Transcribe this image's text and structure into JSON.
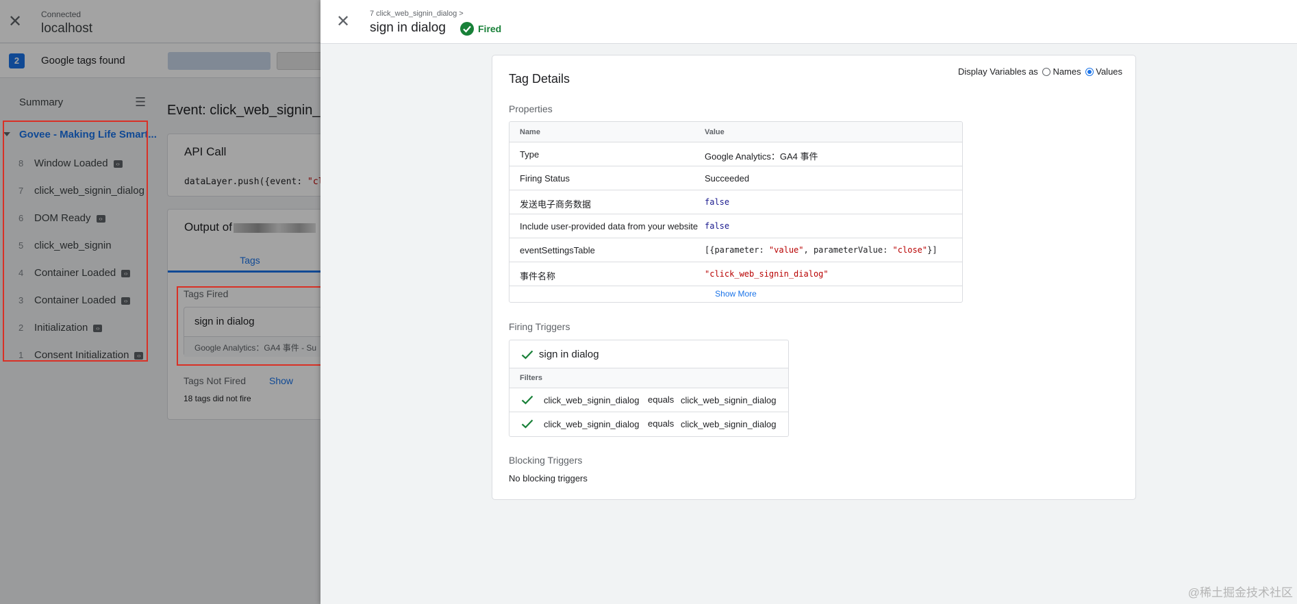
{
  "app": {
    "connected_label": "Connected",
    "host": "localhost",
    "tags_count": "2",
    "tags_found_label": "Google tags found",
    "summary_label": "Summary",
    "root_event": "Govee - Making Life Smart...",
    "events": [
      {
        "num": "8",
        "name": "Window Loaded",
        "badge": true
      },
      {
        "num": "7",
        "name": "click_web_signin_dialog",
        "badge": false
      },
      {
        "num": "6",
        "name": "DOM Ready",
        "badge": true
      },
      {
        "num": "5",
        "name": "click_web_signin",
        "badge": false
      },
      {
        "num": "4",
        "name": "Container Loaded",
        "badge": true
      },
      {
        "num": "3",
        "name": "Container Loaded",
        "badge": true
      },
      {
        "num": "2",
        "name": "Initialization",
        "badge": true
      },
      {
        "num": "1",
        "name": "Consent Initialization",
        "badge": true
      }
    ],
    "event_title": "Event: click_web_signin_c",
    "api_call_title": "API Call",
    "api_code_prefix": "dataLayer.push({event: ",
    "api_code_string": "\"cl",
    "output_title": "Output of",
    "tab_tags": "Tags",
    "tags_fired_label": "Tags Fired",
    "fired_tag_name": "sign in dialog",
    "fired_tag_sub": "Google Analytics：GA4 事件 - Su",
    "tags_not_fired_label": "Tags Not Fired",
    "show_link": "Show",
    "not_fired_count": "18 tags did not fire"
  },
  "panel": {
    "breadcrumb": "7 click_web_signin_dialog >",
    "title": "sign in dialog",
    "status": "Fired",
    "details_title": "Tag Details",
    "display_vars_label": "Display Variables as",
    "names_option": "Names",
    "values_option": "Values",
    "properties_label": "Properties",
    "props_col_name": "Name",
    "props_col_value": "Value",
    "properties": [
      {
        "name": "Type",
        "value": "Google Analytics：GA4 事件"
      },
      {
        "name": "Firing Status",
        "value": "Succeeded"
      },
      {
        "name": "发送电子商务数据",
        "value": "false"
      },
      {
        "name": "Include user-provided data from your website",
        "value": "false"
      },
      {
        "name": "eventSettingsTable",
        "value": "[{parameter: \"value\", parameterValue: \"close\"}]"
      },
      {
        "name": "事件名称",
        "value": "\"click_web_signin_dialog\""
      }
    ],
    "show_more": "Show More",
    "firing_triggers_label": "Firing Triggers",
    "trigger_name": "sign in dialog",
    "filters_label": "Filters",
    "filters": [
      {
        "variable": "click_web_signin_dialog",
        "operator": "equals",
        "value": "click_web_signin_dialog"
      },
      {
        "variable": "click_web_signin_dialog",
        "operator": "equals",
        "value": "click_web_signin_dialog"
      }
    ],
    "blocking_triggers_label": "Blocking Triggers",
    "no_blocking": "No blocking triggers"
  },
  "watermark": "@稀土掘金技术社区",
  "colors": {
    "accent": "#1a73e8",
    "fired": "#188038",
    "highlight_box": "#d93025"
  }
}
